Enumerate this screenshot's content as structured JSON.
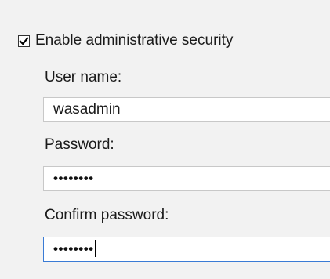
{
  "security": {
    "enable_label": "Enable administrative security",
    "enabled": true
  },
  "fields": {
    "username": {
      "label": "User name:",
      "value": "wasadmin"
    },
    "password": {
      "label": "Password:",
      "masked_value": "••••••••"
    },
    "confirm_password": {
      "label": "Confirm password:",
      "masked_value": "••••••••"
    }
  },
  "icons": {
    "checkbox_mark": "check-icon"
  }
}
